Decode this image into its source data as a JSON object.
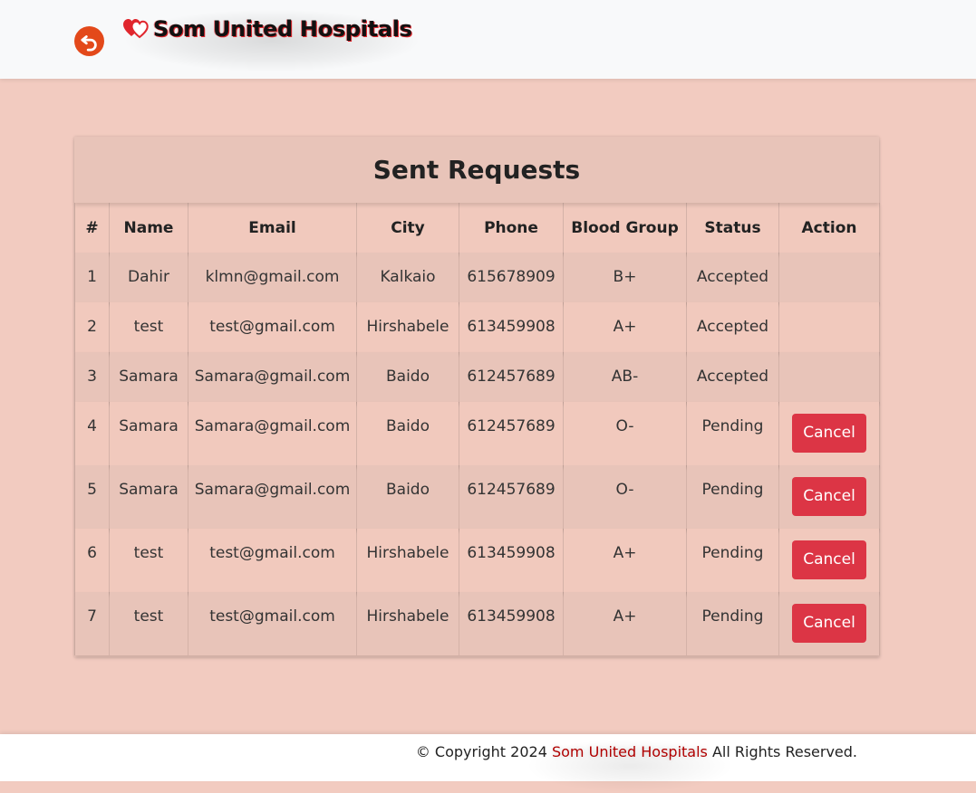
{
  "navbar": {
    "back_icon": "undo-arrow-icon",
    "brand_icon": "hearts-icon",
    "brand_name": "Som United Hospitals",
    "brand_color": "#e0262d"
  },
  "main": {
    "title": "Sent Requests",
    "columns": [
      "#",
      "Name",
      "Email",
      "City",
      "Phone",
      "Blood Group",
      "Status",
      "Action"
    ],
    "rows": [
      {
        "num": "1",
        "name": "Dahir",
        "email": "klmn@gmail.com",
        "city": "Kalkaio",
        "phone": "615678909",
        "blood": "B+",
        "status": "Accepted",
        "action": ""
      },
      {
        "num": "2",
        "name": "test",
        "email": "test@gmail.com",
        "city": "Hirshabele",
        "phone": "613459908",
        "blood": "A+",
        "status": "Accepted",
        "action": ""
      },
      {
        "num": "3",
        "name": "Samara",
        "email": "Samara@gmail.com",
        "city": "Baido",
        "phone": "612457689",
        "blood": "AB-",
        "status": "Accepted",
        "action": ""
      },
      {
        "num": "4",
        "name": "Samara",
        "email": "Samara@gmail.com",
        "city": "Baido",
        "phone": "612457689",
        "blood": "O-",
        "status": "Pending",
        "action": "Cancel"
      },
      {
        "num": "5",
        "name": "Samara",
        "email": "Samara@gmail.com",
        "city": "Baido",
        "phone": "612457689",
        "blood": "O-",
        "status": "Pending",
        "action": "Cancel"
      },
      {
        "num": "6",
        "name": "test",
        "email": "test@gmail.com",
        "city": "Hirshabele",
        "phone": "613459908",
        "blood": "A+",
        "status": "Pending",
        "action": "Cancel"
      },
      {
        "num": "7",
        "name": "test",
        "email": "test@gmail.com",
        "city": "Hirshabele",
        "phone": "613459908",
        "blood": "A+",
        "status": "Pending",
        "action": "Cancel"
      }
    ],
    "cancel_color": "#dc3545"
  },
  "footer": {
    "prefix": "© Copyright 2024",
    "brand": "Som United Hospitals",
    "suffix": "All Rights Reserved."
  }
}
